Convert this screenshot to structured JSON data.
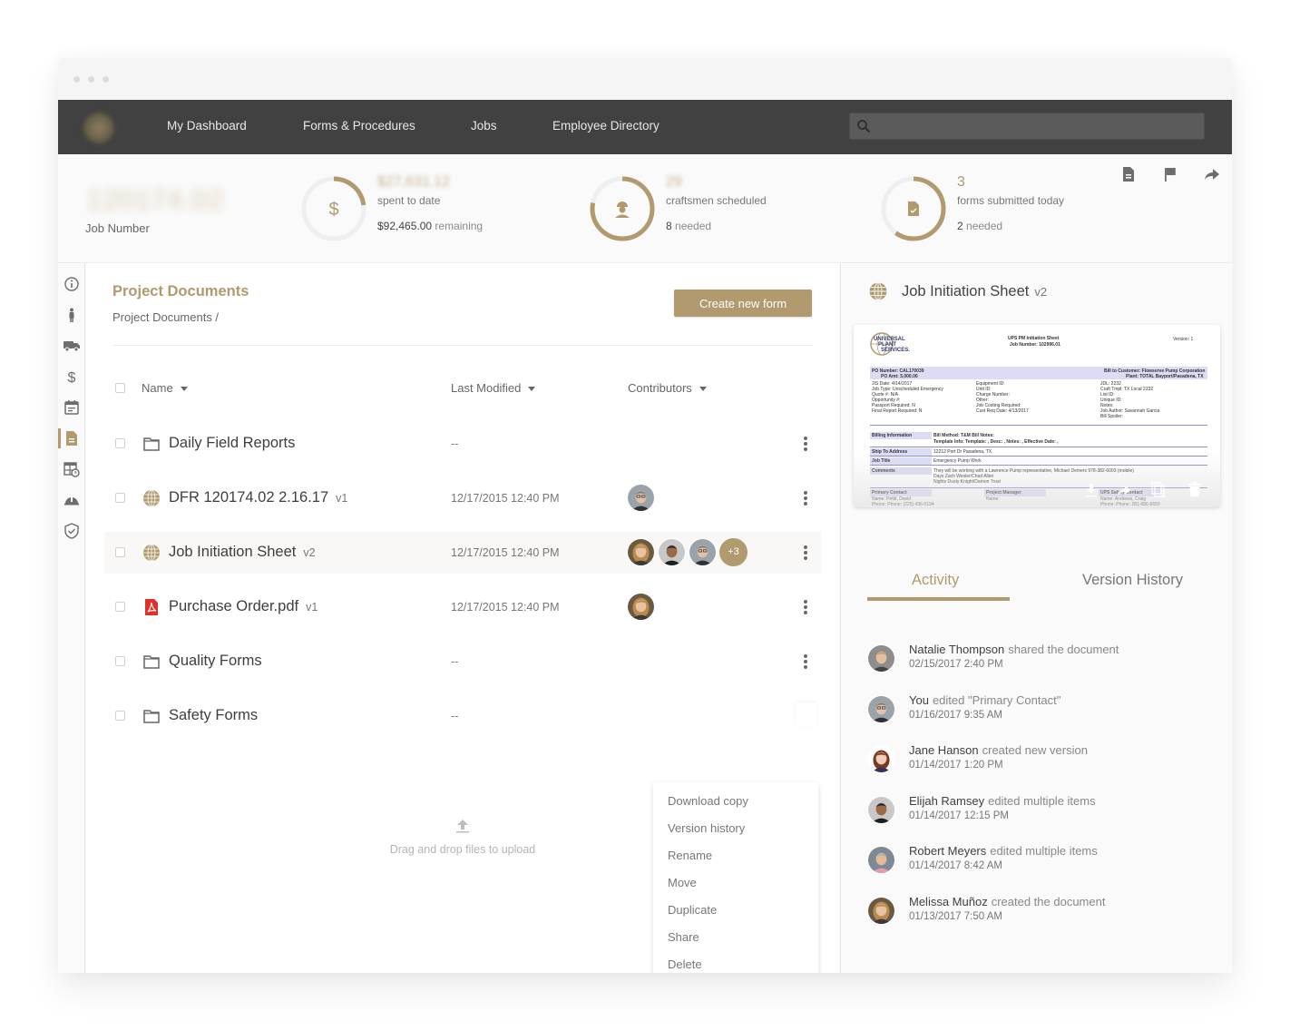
{
  "window": {
    "controls": [
      "close",
      "minimize",
      "maximize"
    ]
  },
  "nav": {
    "logo": "company-logo",
    "items": [
      {
        "label": "My Dashboard"
      },
      {
        "label": "Forms & Procedures"
      },
      {
        "label": "Jobs"
      },
      {
        "label": "Employee Directory"
      }
    ],
    "search": {
      "placeholder": "",
      "value": "",
      "icon": "search-icon"
    }
  },
  "stats": {
    "job_number_value": "120174.02",
    "job_number_label": "Job Number",
    "budget": {
      "icon": "dollar-icon",
      "value": "$27,631.12",
      "caption": "spent to date",
      "remaining_value": "$92,465.00",
      "remaining_label": "remaining",
      "progress": 0.23
    },
    "craftsmen": {
      "icon": "worker-icon",
      "value": "29",
      "caption": "craftsmen scheduled",
      "needed_value": "8",
      "needed_label": "needed",
      "progress": 0.78
    },
    "forms": {
      "icon": "form-check-icon",
      "value": "3",
      "caption": "forms submitted today",
      "needed_value": "2",
      "needed_label": "needed",
      "progress": 0.6
    },
    "actions": [
      "document-icon",
      "flag-icon",
      "share-icon"
    ]
  },
  "rail": {
    "items": [
      "info-icon",
      "person-icon",
      "truck-icon",
      "dollar-icon",
      "calendar-icon",
      "document-icon",
      "schedule-table-icon",
      "hardhat-icon",
      "shield-check-icon"
    ],
    "active_index": 5
  },
  "docs": {
    "title": "Project Documents",
    "breadcrumb": "Project Documents /",
    "create_button": "Create new form",
    "columns": {
      "name": "Name",
      "modified": "Last Modified",
      "contributors": "Contributors"
    },
    "rows": [
      {
        "type": "folder",
        "name": "Daily Field Reports",
        "version": "",
        "modified": "--",
        "contributors": [],
        "extra": ""
      },
      {
        "type": "form",
        "name": "DFR 120174.02 2.16.17",
        "version": "v1",
        "modified": "12/17/2015 12:40 PM",
        "contributors": [
          "man-glasses"
        ],
        "extra": ""
      },
      {
        "type": "form",
        "name": "Job Initiation Sheet",
        "version": "v2",
        "modified": "12/17/2015 12:40 PM",
        "contributors": [
          "woman-blonde",
          "man-dark",
          "man-glasses"
        ],
        "extra": "+3"
      },
      {
        "type": "pdf",
        "name": "Purchase Order.pdf",
        "version": "v1",
        "modified": "12/17/2015 12:40 PM",
        "contributors": [
          "woman-blonde"
        ],
        "extra": ""
      },
      {
        "type": "folder",
        "name": "Quality Forms",
        "version": "",
        "modified": "--",
        "contributors": [],
        "extra": ""
      },
      {
        "type": "folder",
        "name": "Safety Forms",
        "version": "",
        "modified": "--",
        "contributors": [],
        "extra": ""
      }
    ],
    "upload_text": "Drag and drop files to upload",
    "context_menu": [
      "Download copy",
      "Version history",
      "Rename",
      "Move",
      "Duplicate",
      "Share",
      "Delete"
    ]
  },
  "detail": {
    "title": "Job Initiation Sheet",
    "version": "v2",
    "preview": {
      "logo_text": [
        "UNIVERSAL",
        "PLANT",
        "SERVICES."
      ],
      "heading": "UPS PM Initiation Sheet",
      "job_number": "Job Number:   102996.01",
      "version": "Version:  1",
      "po_number": "PO Number:    CAL170039",
      "po_amt": "PO Amt:    5,000.00",
      "bill_to": "Bill to Customer: Flowserve Pump Corporation",
      "plant": "Plant: TOTAL Bayport/Pasadena, TX",
      "col1": [
        "JIS Date:      4/14/2017",
        "Job Type:      Unscheduled Emergency",
        "Quote #:       N/A",
        "Opportunity #:",
        "Passport Required:     N",
        "Final Report Required:     N"
      ],
      "col2": [
        "Equipment ID:",
        "Unit ID:",
        "Charge Number:",
        "Other:",
        "Job Costing Required:",
        "Cust Req Date:        4/13/2017"
      ],
      "col3": [
        "JDL:        2232",
        "Craft Tmpl:   TX Local 2232",
        "List ID:",
        "Unique ID:",
        "Notes:",
        "Job Author:  Savannah Garcia",
        "Bill Spoiler:"
      ],
      "billing_label": "Billing Information",
      "billing": [
        "Bill Method:      T&M      Bill Notes:",
        "Template Info:    Template: , Desc: , Notes: , Effective Date: ,"
      ],
      "ship_label": "Ship To Address",
      "ship": "12212 Port Dr     Pasadena, TX",
      "jobtitle_label": "Job Title",
      "jobtitle": "Emergency Pump Work",
      "comments_label": "Comments",
      "comments": [
        "They will be working with a Lawrence Pump representative, Michael Demers 978-382-6003 (mobile)",
        "Days Zach Wesler/Chad Allen",
        "Nights Dusty Knight/Damon Trost"
      ],
      "primary_contact": "Primary Contact",
      "primary_lines": [
        "Name:     Pettit, David",
        "Phone:    Phone: (225) 436-0194"
      ],
      "project_manager": "Project Manager",
      "pm_lines": [
        "Name:",
        "Phone:"
      ],
      "safety_contact": "UPS Safety Contact",
      "safety_lines": [
        "Name:     Andrews, Craig",
        "Phone:    Phone: 281-686-6659"
      ],
      "actions": [
        "download-icon",
        "share-icon",
        "copy-icon",
        "trash-icon"
      ]
    },
    "tabs": [
      {
        "label": "Activity",
        "active": true
      },
      {
        "label": "Version History",
        "active": false
      }
    ],
    "activity": [
      {
        "user": "Natalie Thompson",
        "action": "shared the document",
        "time": "02/15/2017 2:40 PM",
        "avatar": "woman-short"
      },
      {
        "user": "You",
        "action": "edited \"Primary Contact\"",
        "time": "01/16/2017 9:35 AM",
        "avatar": "man-glasses"
      },
      {
        "user": "Jane Hanson",
        "action": "created new version",
        "time": "01/14/2017 1:20 PM",
        "avatar": "woman-red"
      },
      {
        "user": "Elijah Ramsey",
        "action": "edited multiple items",
        "time": "01/14/2017 12:15 PM",
        "avatar": "man-dark"
      },
      {
        "user": "Robert Meyers",
        "action": "edited multiple items",
        "time": "01/14/2017 8:42 AM",
        "avatar": "man-grey"
      },
      {
        "user": "Melissa Muñoz",
        "action": "created the document",
        "time": "01/13/2017 7:50 AM",
        "avatar": "woman-blonde"
      }
    ]
  },
  "colors": {
    "accent": "#b09a6e",
    "navbar": "#414141",
    "pdf_red": "#e0302a"
  }
}
